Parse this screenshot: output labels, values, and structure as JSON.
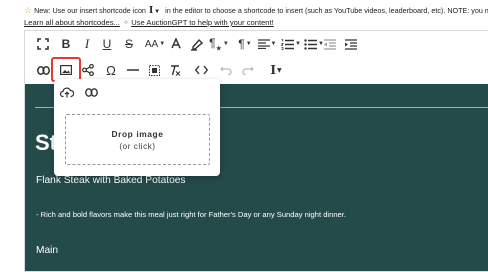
{
  "notice": {
    "star": "☆",
    "text_before": "New: Use our insert shortcode icon",
    "text_after": "in the editor to choose a shortcode to insert (such as YouTube videos, leaderboard, etc). NOTE: you may need to provide"
  },
  "links": {
    "shortcodes": "Learn all about shortcodes...",
    "auctiongpt": "Use AuctionGPT to help with your content!"
  },
  "toolbar": {
    "font_size_label": "AA",
    "icons_row1": [
      "fullscreen-icon",
      "bold-icon",
      "italic-icon",
      "underline-icon",
      "strikethrough-icon",
      "font-size-icon",
      "text-color-icon",
      "highlighter-icon",
      "paragraph-style-icon",
      "paragraph-format-icon",
      "align-icon",
      "ordered-list-icon",
      "unordered-list-icon",
      "outdent-icon",
      "indent-icon"
    ],
    "icons_row2": [
      "insert-link-icon",
      "insert-image-icon",
      "share-icon",
      "special-characters-icon",
      "horizontal-line-icon",
      "select-all-icon",
      "clear-formatting-icon",
      "code-view-icon",
      "undo-icon",
      "redo-icon",
      "insert-shortcode-icon"
    ]
  },
  "content": {
    "big_initial": "St",
    "heading": "Flank Steak with Baked Potatoes",
    "paragraph": "- Rich and bold flavors make this meal just right for Father's Day or any Sunday night dinner.",
    "subheading": "Main",
    "background": "#244a4a"
  },
  "image_popup": {
    "drop_title": "Drop image",
    "drop_hint": "(or click)"
  },
  "colors": {
    "active_outline": "#e53935",
    "notice_star": "#f0b400"
  }
}
